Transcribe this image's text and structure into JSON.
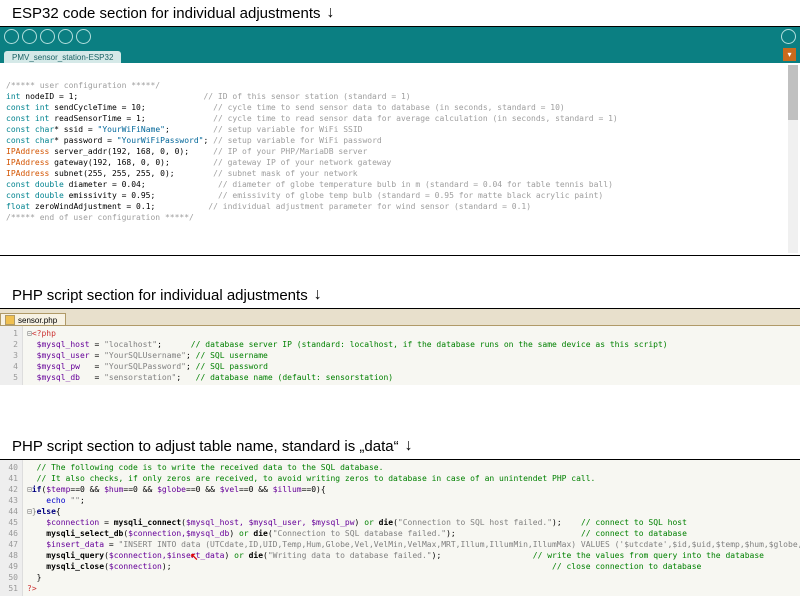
{
  "section1": {
    "title": "ESP32 code section for individual adjustments",
    "tab": "PMV_sensor_station-ESP32",
    "code": {
      "c1": "/***** user configuration *****/",
      "l1a": "int",
      "l1b": " nodeID = 1;",
      "l1c": "// ID of this sensor station (standard = 1)",
      "l2a": "const int",
      "l2b": " sendCycleTime = 10;",
      "l2c": "// cycle time to send sensor data to database (in seconds, standard = 10)",
      "l3a": "const int",
      "l3b": " readSensorTime = 1;",
      "l3c": "// cycle time to read sensor data for average calculation (in seconds, standard = 1)",
      "l4a": "const char",
      "l4b": "* ssid = ",
      "l4s": "\"YourWiFiName\"",
      "l4e": ";",
      "l4c": "// setup variable for WiFi SSID",
      "l5a": "const char",
      "l5b": "* password = ",
      "l5s": "\"YourWiFiPassword\"",
      "l5e": ";",
      "l5c": "// setup variable for WiFi password",
      "l6a": "IPAddress",
      "l6b": " server_addr(192, 168, 0, 0);",
      "l6c": "// IP of your PHP/MariaDB server",
      "l7a": "IPAddress",
      "l7b": " gateway(192, 168, 0, 0);",
      "l7c": "// gateway IP of your network gateway",
      "l8a": "IPAddress",
      "l8b": " subnet(255, 255, 255, 0);",
      "l8c": "// subnet mask of your network",
      "l9a": "const double",
      "l9b": " diameter = 0.04;",
      "l9c": "// diameter of globe temperature bulb in m (standard = 0.04 for table tennis ball)",
      "l10a": "const double",
      "l10b": " emissivity = 0.95;",
      "l10c": "// emissivity of globe temp bulb (standard = 0.95 for matte black acrylic paint)",
      "l11a": "float",
      "l11b": " zeroWindAdjustment = 0.1;",
      "l11c": "// individual adjustment parameter for wind sensor (standard = 0.1)",
      "c2": "/***** end of user configuration *****/"
    }
  },
  "section2": {
    "title": "PHP script section for individual adjustments",
    "tab": "sensor.php",
    "gutter": "1\n2\n3\n4\n5",
    "l1o": "⊟",
    "l1": "<?php",
    "l2v": "$mysql_host",
    "l2e": " = ",
    "l2s": "\"localhost\"",
    "l2t": ";",
    "l2c": "// database server IP (standard: localhost, if the database runs on the same device as this script)",
    "l3v": "$mysql_user",
    "l3e": " = ",
    "l3s": "\"YourSQLUsername\"",
    "l3t": ";",
    "l3c": "// SQL username",
    "l4v": "$mysql_pw",
    "l4e": "   = ",
    "l4s": "\"YourSQLPassword\"",
    "l4t": ";",
    "l4c": "// SQL password",
    "l5v": "$mysql_db",
    "l5e": "   = ",
    "l5s": "\"sensorstation\"",
    "l5t": ";",
    "l5c": "// database name (default: sensorstation)"
  },
  "section3": {
    "title": "PHP script section to adjust table name, standard is „data“",
    "gutter": "40\n41\n42\n43\n44\n45\n46\n47\n48\n49\n50\n51",
    "l40": "// The following code is to write the received data to the SQL database.",
    "l41": "// It also checks, if only zeros are received, to avoid writing zeros to database in case of an unintendet PHP call.",
    "l42a": "⊟",
    "l42if": "if",
    "l42p": "(",
    "l42v1": "$temp",
    "l42op": "==0 && ",
    "l42v2": "$hum",
    "l42op2": "==0 && ",
    "l42v3": "$globe",
    "l42op3": "==0 && ",
    "l42v4": "$vel",
    "l42op4": "==0 && ",
    "l42v5": "$illum",
    "l42op5": "==0){",
    "l43a": "    ",
    "l43e": "echo",
    "l43s": " \"\"",
    "l43t": ";",
    "l44a": "⊟}",
    "l44e": "else",
    "l44b": "{",
    "l45a": "    ",
    "l45v": "$connection",
    "l45e": " = ",
    "l45f": "mysqli_connect",
    "l45p": "(",
    "l45args": "$mysql_host, $mysql_user, $mysql_pw",
    "l45p2": ") ",
    "l45or": "or",
    "l45d": " die",
    "l45dp": "(",
    "l45ds": "\"Connection to SQL host failed.\"",
    "l45de": ");",
    "l45c": "// connect to SQL host",
    "l46a": "    ",
    "l46f": "mysqli_select_db",
    "l46p": "(",
    "l46args": "$connection,$mysql_db",
    "l46p2": ") ",
    "l46or": "or",
    "l46d": " die",
    "l46dp": "(",
    "l46ds": "\"Connection to SQL database failed.\"",
    "l46de": ");",
    "l46c": "// connect to database",
    "l47a": "    ",
    "l47v": "$insert_data",
    "l47e": " = ",
    "l47s": "\"INSERT INTO data (UTCdate,ID,UID,Temp,Hum,Globe,Vel,VelMin,VelMax,MRT,Illum,IllumMin,IllumMax) VALUES ('$utcdate',$id,$uid,$temp,$hum,$globe,$vel,$velmin,$velmax,$mrt",
    "l47t": ";",
    "l48a": "    ",
    "l48f": "mysqli_query",
    "l48p": "(",
    "l48args": "$connection,$insert_data",
    "l48p2": ") ",
    "l48or": "or",
    "l48d": " die",
    "l48dp": "(",
    "l48ds": "\"Writing data to database failed.\"",
    "l48de": ");",
    "l48c": "// write the values from query into the database",
    "l49a": "    ",
    "l49f": "mysqli_close",
    "l49p": "(",
    "l49args": "$connection",
    "l49p2": ");",
    "l49c": "// close connection to database",
    "l50": "}",
    "l51": "?>"
  }
}
